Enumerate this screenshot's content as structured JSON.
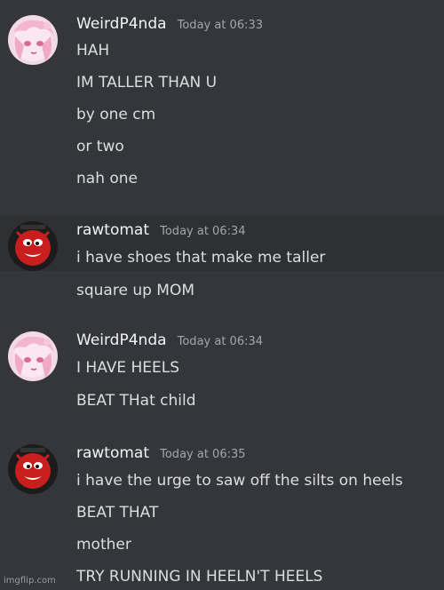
{
  "messages": [
    {
      "author": "WeirdP4nda",
      "timestamp": "Today at 06:33",
      "avatar": "anime-girl-pink-avatar",
      "lines": [
        "HAH",
        "IM TALLER THAN U",
        "by one cm",
        "or two",
        "nah one"
      ]
    },
    {
      "author": "rawtomat",
      "timestamp": "Today at 06:34",
      "avatar": "red-cartoon-mascot-avatar",
      "lines": [
        "i have shoes that make me taller",
        "square up MOM"
      ]
    },
    {
      "author": "WeirdP4nda",
      "timestamp": "Today at 06:34",
      "avatar": "anime-girl-pink-avatar",
      "lines": [
        "I HAVE HEELS",
        "BEAT THat child"
      ]
    },
    {
      "author": "rawtomat",
      "timestamp": "Today at 06:35",
      "avatar": "red-cartoon-mascot-avatar",
      "lines": [
        "i have the urge to saw off the silts on heels",
        "BEAT THAT",
        "mother",
        "TRY RUNNING IN HEELN'T HEELS"
      ]
    }
  ],
  "watermark": "imgflip.com",
  "colors": {
    "background": "#35363b",
    "hover_background": "#2f3034",
    "username": "#f2f3f5",
    "message_text": "#dcddde",
    "timestamp": "#a3a6aa"
  }
}
